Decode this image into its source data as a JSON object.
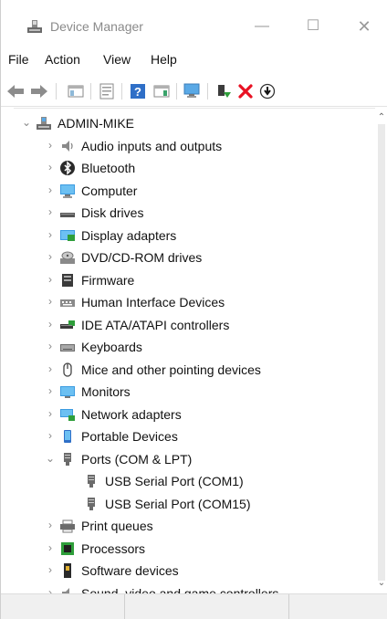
{
  "window": {
    "title": "Device Manager",
    "controls": {
      "minimize": "—",
      "maximize": "☐",
      "close": "✕"
    }
  },
  "menu": {
    "items": [
      "File",
      "Action",
      "View",
      "Help"
    ]
  },
  "toolbar": {
    "buttons": [
      "back-icon",
      "forward-icon",
      "show-hide-console-tree-icon",
      "properties-icon",
      "help-icon",
      "show-action-pane-icon",
      "update-driver-icon",
      "enable-device-icon",
      "uninstall-device-icon",
      "download-icon"
    ]
  },
  "tree": {
    "root": "ADMIN-MIKE",
    "categories": [
      {
        "label": "Audio inputs and outputs",
        "icon": "audio-icon"
      },
      {
        "label": "Bluetooth",
        "icon": "bluetooth-icon"
      },
      {
        "label": "Computer",
        "icon": "computer-icon"
      },
      {
        "label": "Disk drives",
        "icon": "disk-drive-icon"
      },
      {
        "label": "Display adapters",
        "icon": "display-adapter-icon"
      },
      {
        "label": "DVD/CD-ROM drives",
        "icon": "dvd-drive-icon"
      },
      {
        "label": "Firmware",
        "icon": "firmware-icon"
      },
      {
        "label": "Human Interface Devices",
        "icon": "hid-icon"
      },
      {
        "label": "IDE ATA/ATAPI controllers",
        "icon": "ide-controller-icon"
      },
      {
        "label": "Keyboards",
        "icon": "keyboard-icon"
      },
      {
        "label": "Mice and other pointing devices",
        "icon": "mouse-icon"
      },
      {
        "label": "Monitors",
        "icon": "monitor-icon"
      },
      {
        "label": "Network adapters",
        "icon": "network-adapter-icon"
      },
      {
        "label": "Portable Devices",
        "icon": "portable-device-icon"
      },
      {
        "label": "Ports (COM & LPT)",
        "icon": "port-icon",
        "expanded": true,
        "children": [
          "USB Serial Port (COM1)",
          "USB Serial Port (COM15)"
        ]
      },
      {
        "label": "Print queues",
        "icon": "printer-icon"
      },
      {
        "label": "Processors",
        "icon": "processor-icon"
      },
      {
        "label": "Software devices",
        "icon": "software-device-icon"
      },
      {
        "label": "Sound, video and game controllers",
        "icon": "sound-controller-icon"
      }
    ]
  },
  "colors": {
    "accent_blue": "#1e88d8",
    "icon_gray": "#707070",
    "uninstall_red": "#e81123",
    "enable_green": "#2e9e3a"
  }
}
